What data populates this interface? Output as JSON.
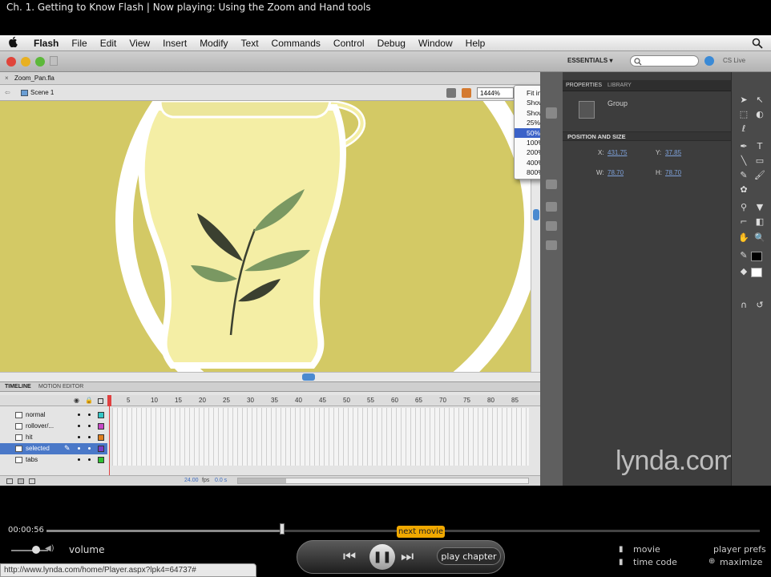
{
  "title_bar": {
    "text": "Ch. 1. Getting to Know Flash | Now playing: Using the Zoom and Hand tools"
  },
  "menubar": {
    "app_name": "Flash",
    "items": [
      "File",
      "Edit",
      "View",
      "Insert",
      "Modify",
      "Text",
      "Commands",
      "Control",
      "Debug",
      "Window",
      "Help"
    ]
  },
  "toolbar": {
    "workspace": "ESSENTIALS ▾",
    "cs_live": "CS Live",
    "search_placeholder": ""
  },
  "document": {
    "tab_name": "Zoom_Pan.fla",
    "scene": "Scene 1",
    "zoom_value": "1444%"
  },
  "zoom_menu": {
    "items": [
      "Fit in Window",
      "Show Frame",
      "Show All",
      "25%",
      "50%",
      "100%",
      "200%",
      "400%",
      "800%"
    ],
    "selected_index": 4
  },
  "properties": {
    "tab_properties": "PROPERTIES",
    "tab_library": "LIBRARY",
    "instance_type": "Group",
    "section_title": "POSITION AND SIZE",
    "x_label": "X:",
    "x_value": "431.75",
    "y_label": "Y:",
    "y_value": "37.85",
    "w_label": "W:",
    "w_value": "78.70",
    "h_label": "H:",
    "h_value": "78.70"
  },
  "timeline": {
    "tab_timeline": "TIMELINE",
    "tab_motion_editor": "MOTION EDITOR",
    "frame_numbers": [
      "5",
      "10",
      "15",
      "20",
      "25",
      "30",
      "35",
      "40",
      "45",
      "50",
      "55",
      "60",
      "65",
      "70",
      "75",
      "80",
      "85"
    ],
    "layers": [
      {
        "name": "normal",
        "color": "#33c6c6",
        "selected": false
      },
      {
        "name": "rollover/...",
        "color": "#c648c6",
        "selected": false
      },
      {
        "name": "hit",
        "color": "#e08020",
        "selected": false
      },
      {
        "name": "selected",
        "color": "#7a3cc8",
        "selected": true
      },
      {
        "name": "tabs",
        "color": "#30c030",
        "selected": false
      }
    ],
    "fps": "24.00",
    "fps_unit": "fps",
    "time": "0.0 s"
  },
  "watermark": "lynda.com",
  "player": {
    "timecode": "00:00:56",
    "progress": 0.33,
    "next_movie": "next movie",
    "volume_label": "volume",
    "play_chapter": "play chapter",
    "movie": "movie",
    "time_code": "time code",
    "player_prefs": "player prefs",
    "maximize": "maximize",
    "status_url": "http://www.lynda.com/home/Player.aspx?lpk4=64737#"
  },
  "colors": {
    "stage_bg": "#d3c965",
    "jar_fill": "#f4eea5",
    "leaf_dark": "#3b4030",
    "leaf_light": "#7a9862",
    "menu_highlight": "#3b62c8",
    "next_movie_bg": "#f0a800"
  }
}
